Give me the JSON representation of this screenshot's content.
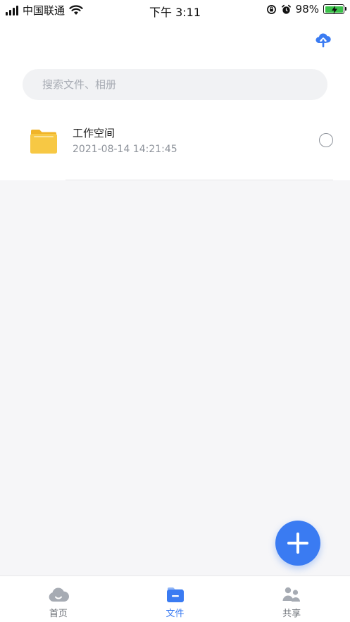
{
  "status_bar": {
    "carrier": "中国联通",
    "time": "下午 3:11",
    "battery": "98%"
  },
  "search": {
    "placeholder": "搜索文件、相册"
  },
  "files": [
    {
      "name": "工作空间",
      "date": "2021-08-14 14:21:45",
      "icon": "folder-icon"
    }
  ],
  "tabs": [
    {
      "label": "首页",
      "icon": "cloud-home-icon",
      "active": false
    },
    {
      "label": "文件",
      "icon": "file-folder-icon",
      "active": true
    },
    {
      "label": "共享",
      "icon": "people-share-icon",
      "active": false
    }
  ],
  "colors": {
    "accent": "#3a7bf2",
    "folder": "#f7c844",
    "background": "#f6f6f8"
  }
}
